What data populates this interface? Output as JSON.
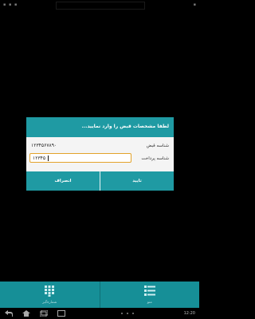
{
  "dialog": {
    "title": "لطفا مشخصات قبض را وارد نمایید...",
    "bill_id_label": "شناسه قبض",
    "bill_id_value": "۱۲۳۴۵۶۷۸۹۰",
    "payment_id_label": "شناسه پرداخت",
    "payment_id_value": "۱۲۳۴۵",
    "confirm_label": "تایید",
    "cancel_label": "انصراف"
  },
  "tabs": [
    {
      "label": "منو",
      "icon": "menu-list-icon"
    },
    {
      "label": "شماره‌گیر",
      "icon": "dialpad-icon"
    }
  ],
  "system": {
    "clock": "12:20"
  },
  "colors": {
    "accent": "#1f9aa3",
    "tab_bar": "#168f97",
    "input_border": "#e3a32b"
  }
}
